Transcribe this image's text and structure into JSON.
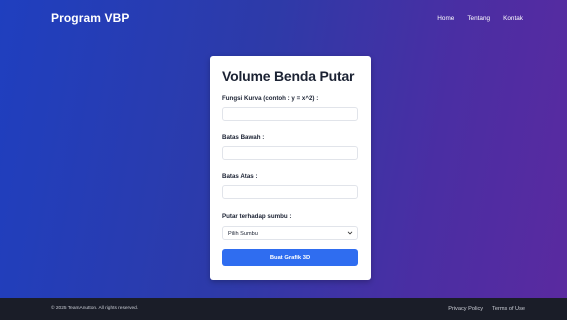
{
  "header": {
    "brand": "Program VBP",
    "nav": [
      "Home",
      "Tentang",
      "Kontak"
    ]
  },
  "form": {
    "title": "Volume Benda Putar",
    "function_label": "Fungsi Kurva (contoh : y = x^2) :",
    "function_value": "",
    "lower_label": "Batas Bawah :",
    "lower_value": "",
    "upper_label": "Batas Atas :",
    "upper_value": "",
    "axis_label": "Putar terhadap sumbu :",
    "axis_selected": "Pilih Sumbu",
    "submit_label": "Buat Grafik 3D"
  },
  "footer": {
    "copyright": "© 2025 TeamAnutton. All rights reserved.",
    "links": [
      "Privacy Policy",
      "Terms of Use"
    ]
  },
  "colors": {
    "gradient_start": "#1f3fbf",
    "gradient_end": "#5a2aa0",
    "button": "#2f6df0",
    "footer": "#1a1d28"
  },
  "icons": {
    "select_chevron": "chevron-down-icon"
  }
}
